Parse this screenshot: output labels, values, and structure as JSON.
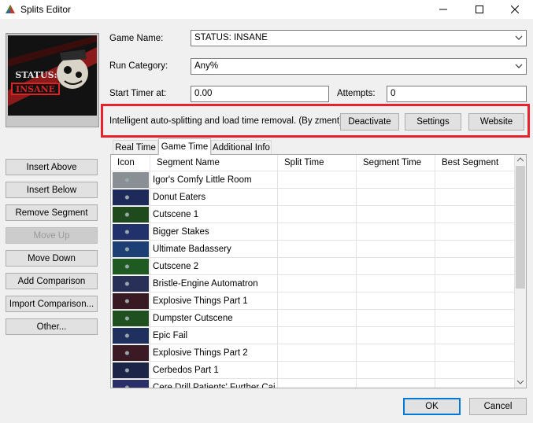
{
  "window": {
    "title": "Splits Editor"
  },
  "cover": {
    "line1": "STATUS:",
    "line2": "INSANE"
  },
  "form": {
    "game_name_label": "Game Name:",
    "game_name_value": "STATUS: INSANE",
    "run_category_label": "Run Category:",
    "run_category_value": "Any%",
    "start_timer_label": "Start Timer at:",
    "start_timer_value": "0.00",
    "attempts_label": "Attempts:",
    "attempts_value": "0"
  },
  "autosplitter": {
    "description": "Intelligent auto-splitting and load time removal. (By zment)",
    "deactivate_label": "Deactivate",
    "settings_label": "Settings",
    "website_label": "Website"
  },
  "side_buttons": {
    "insert_above": "Insert Above",
    "insert_below": "Insert Below",
    "remove_segment": "Remove Segment",
    "move_up": "Move Up",
    "move_down": "Move Down",
    "add_comparison": "Add Comparison",
    "import_comparison": "Import Comparison...",
    "other": "Other..."
  },
  "tabs": {
    "real_time": "Real Time",
    "game_time": "Game Time",
    "additional_info": "Additional Info"
  },
  "table": {
    "columns": {
      "icon": "Icon",
      "segment_name": "Segment Name",
      "split_time": "Split Time",
      "segment_time": "Segment Time",
      "best_segment": "Best Segment"
    },
    "rows": [
      {
        "name": "Igor's Comfy Little Room",
        "thumb": "#8a8f96"
      },
      {
        "name": "Donut Eaters",
        "thumb": "#1d2a5a"
      },
      {
        "name": "Cutscene 1",
        "thumb": "#1e4a1e"
      },
      {
        "name": "Bigger Stakes",
        "thumb": "#22306b"
      },
      {
        "name": "Ultimate Badassery",
        "thumb": "#1c3f75"
      },
      {
        "name": "Cutscene 2",
        "thumb": "#1f5a22"
      },
      {
        "name": "Bristle-Engine Automatron",
        "thumb": "#283058"
      },
      {
        "name": "Explosive Things Part 1",
        "thumb": "#3a1a22"
      },
      {
        "name": "Dumpster Cutscene",
        "thumb": "#1e5020"
      },
      {
        "name": "Epic Fail",
        "thumb": "#20305e"
      },
      {
        "name": "Explosive Things Part 2",
        "thumb": "#3b1a26"
      },
      {
        "name": "Cerbedos Part 1",
        "thumb": "#1c2448"
      },
      {
        "name": "Cere Drill Patients' Further Cai",
        "thumb": "#2a2f6a"
      }
    ]
  },
  "footer": {
    "ok_label": "OK",
    "cancel_label": "Cancel"
  }
}
